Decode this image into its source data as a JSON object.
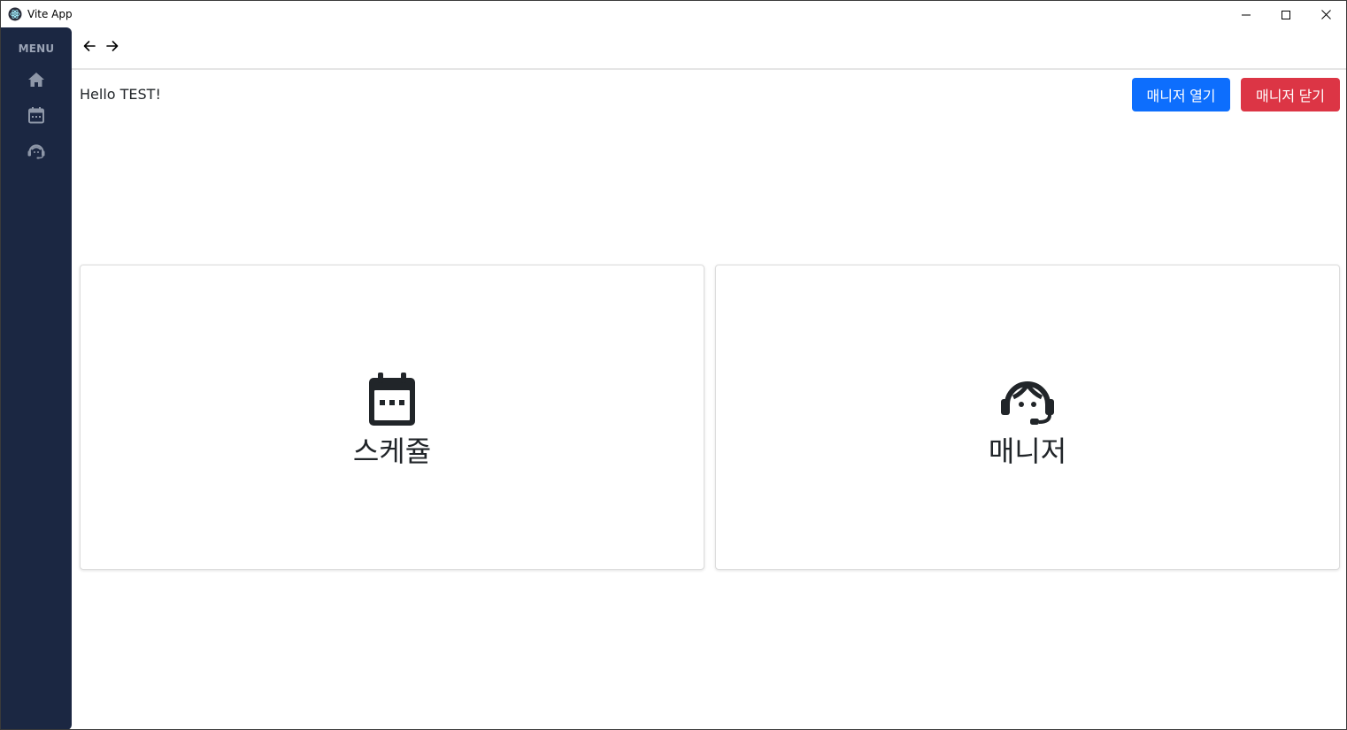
{
  "window": {
    "title": "Vite App",
    "icon": "electron-icon",
    "controls": [
      "minimize-icon",
      "maximize-icon",
      "close-icon"
    ]
  },
  "sidebar": {
    "menu_label": "MENU",
    "items": [
      {
        "icon": "home-icon"
      },
      {
        "icon": "calendar-icon"
      },
      {
        "icon": "headset-icon"
      }
    ]
  },
  "nav": {
    "back_icon": "arrow-left-icon",
    "forward_icon": "arrow-right-icon"
  },
  "main": {
    "greeting": "Hello TEST!",
    "open_manager_label": "매니저 열기",
    "close_manager_label": "매니저 닫기",
    "cards": [
      {
        "label": "스케쥴",
        "icon": "calendar-icon"
      },
      {
        "label": "매니저",
        "icon": "headset-icon"
      }
    ]
  },
  "colors": {
    "sidebar_bg": "#1b2742",
    "primary": "#0d6efd",
    "danger": "#dc3545",
    "sidebar_icon": "#8e97a8"
  }
}
